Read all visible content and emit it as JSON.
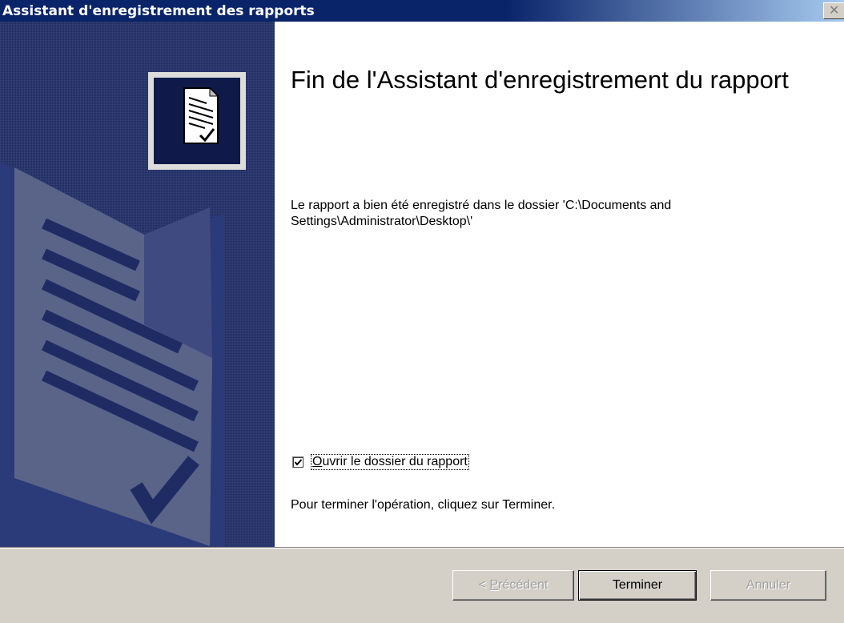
{
  "window": {
    "title": "Assistant d'enregistrement des rapports",
    "close_icon": "close-icon",
    "close_glyph": "✕"
  },
  "sidebar": {
    "icon": "report-document-icon",
    "background_color": "#1f2c64"
  },
  "content": {
    "heading": "Fin de l'Assistant d'enregistrement du rapport",
    "message": "Le rapport a bien été enregistré dans le dossier 'C:\\Documents and Settings\\Administrator\\Desktop\\'",
    "checkbox": {
      "checked": true,
      "label_first": "O",
      "label_rest": "uvrir le dossier du rapport"
    },
    "finish_instruction": "Pour terminer l'opération, cliquez sur Terminer."
  },
  "buttons": {
    "previous_prefix": "< ",
    "previous_accel": "P",
    "previous_rest": "récédent",
    "finish": "Terminer",
    "cancel": "Annuler"
  },
  "colors": {
    "titlebar_start": "#0a246a",
    "titlebar_end": "#a6caf0",
    "window_bg": "#d4d0c8"
  }
}
